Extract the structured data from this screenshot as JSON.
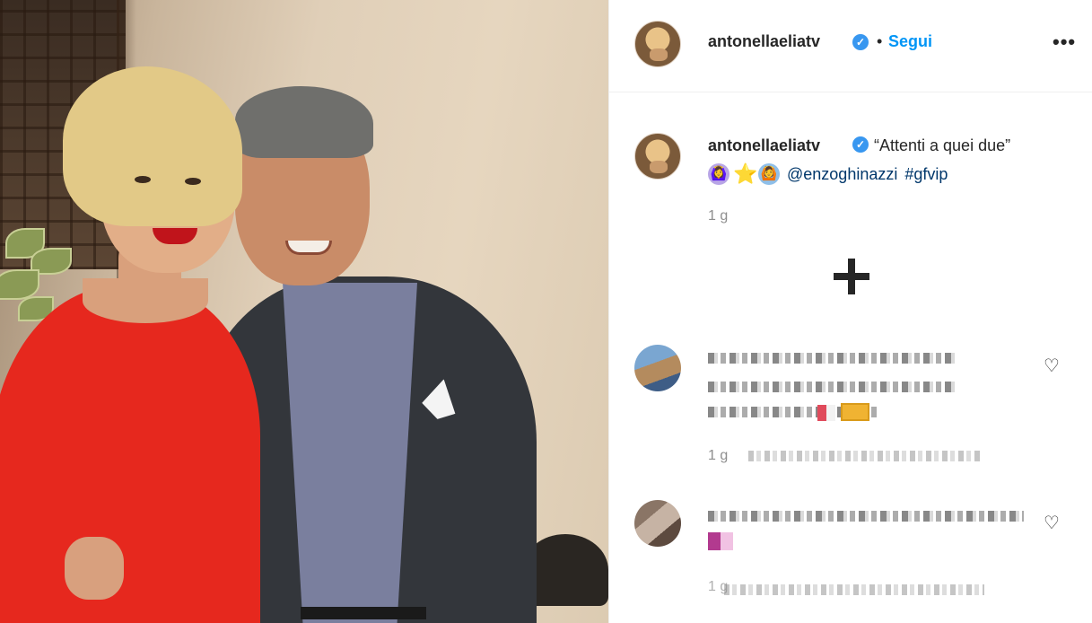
{
  "post": {
    "image_alt_subject": "photo",
    "username": "antonellaeliatv",
    "verified_icon": "verified-badge-icon",
    "follow_label": "Segui",
    "separator": "•",
    "more_label": "•••",
    "caption_text": "“Attenti a quei due”",
    "caption_emojis": [
      "🙆‍♀️",
      "⭐",
      "🙆"
    ],
    "caption_mention": "@enzoghinazzi",
    "caption_hashtag": "#gfvip",
    "age": "1 g",
    "load_more_icon": "plus-circle-icon"
  },
  "comments": [
    {
      "username_blurred": true,
      "text_blurred": true,
      "age": "1 g",
      "meta_blurred": true,
      "like_icon": "heart-icon",
      "like_label": "♡"
    },
    {
      "username_blurred": true,
      "text_blurred": true,
      "age": "1 g",
      "meta_blurred": true,
      "like_icon": "heart-icon",
      "like_label": "♡"
    }
  ],
  "colors": {
    "accent": "#0095f6",
    "verified": "#3897f0",
    "link": "#00376b",
    "muted": "#8e8e8e",
    "dress": "#e6281e"
  }
}
